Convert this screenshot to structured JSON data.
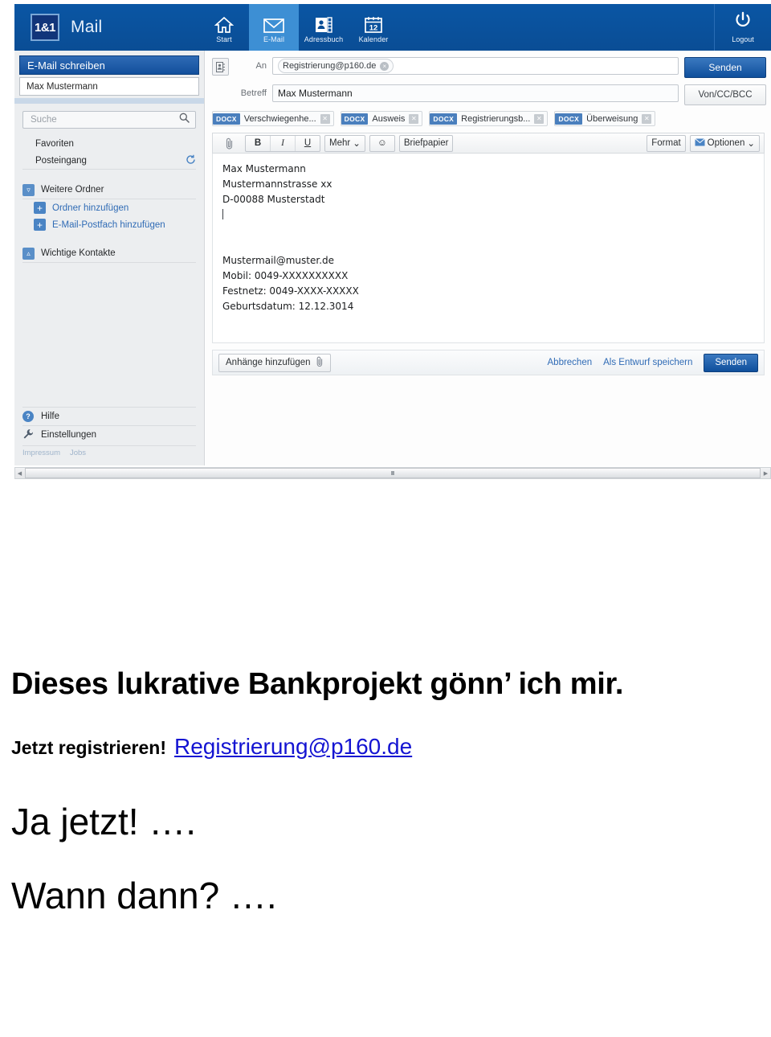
{
  "header": {
    "logo_text": "1&1",
    "brand": "Mail",
    "nav": [
      {
        "label": "Start",
        "icon": "home-icon",
        "active": false
      },
      {
        "label": "E-Mail",
        "icon": "envelope-icon",
        "active": true
      },
      {
        "label": "Adressbuch",
        "icon": "contacts-icon",
        "active": false
      },
      {
        "label": "Kalender",
        "icon": "calendar-icon",
        "active": false
      }
    ],
    "calendar_day": "12",
    "logout": {
      "label": "Logout",
      "icon": "power-icon"
    },
    "accent_blue": "#0a56a4",
    "active_tab_blue": "#3d8fd4"
  },
  "sidebar": {
    "compose_button": "E-Mail schreiben",
    "sender": "Max Mustermann",
    "search": {
      "placeholder": "Suche",
      "value": "",
      "icon": "search-icon"
    },
    "folders": [
      {
        "label": "Favoriten",
        "icon": ""
      },
      {
        "label": "Posteingang",
        "icon": "refresh-icon"
      }
    ],
    "more_folders": {
      "label": "Weitere Ordner",
      "icon": "chevron-double-down-icon"
    },
    "more_items": [
      {
        "label": "Ordner hinzufügen",
        "icon": "plus-icon"
      },
      {
        "label": "E-Mail-Postfach hinzufügen",
        "icon": "plus-icon"
      }
    ],
    "contacts": {
      "label": "Wichtige Kontakte",
      "icon": "chevron-double-up-icon"
    },
    "footer": [
      {
        "label": "Hilfe",
        "icon": "help-icon"
      },
      {
        "label": "Einstellungen",
        "icon": "wrench-icon"
      }
    ],
    "links": [
      "Impressum",
      "Jobs"
    ]
  },
  "compose": {
    "to_label": "An",
    "to_icon": "address-book-icon",
    "recipient": "Registrierung@p160.de",
    "recipient_remove": "×",
    "subject_label": "Betreff",
    "subject": "Max Mustermann",
    "send_button": "Senden",
    "von_cc_bcc_button": "Von/CC/BCC",
    "attachments": [
      {
        "type": "DOCX",
        "name": "Verschwiegenhe..."
      },
      {
        "type": "DOCX",
        "name": "Ausweis"
      },
      {
        "type": "DOCX",
        "name": "Registrierungsb..."
      },
      {
        "type": "DOCX",
        "name": "Überweisung"
      }
    ],
    "toolbar": {
      "attach_icon": "paperclip-icon",
      "bold": "B",
      "italic": "I",
      "underline": "U",
      "more": "Mehr",
      "emoji_icon": "smiley-icon",
      "stationery": "Briefpapier",
      "format": "Format",
      "options": "Optionen",
      "options_icon": "envelope-small-icon"
    },
    "body_lines": [
      "Max Mustermann",
      "Mustermannstrasse xx",
      "D-00088 Musterstadt",
      "",
      "",
      "",
      "Mustermail@muster.de",
      "Mobil: 0049-XXXXXXXXXX",
      "Festnetz: 0049-XXXX-XXXXX",
      "Geburtsdatum: 12.12.3014"
    ],
    "footer": {
      "add_attachments": "Anhänge hinzufügen",
      "add_attachments_icon": "paperclip-icon",
      "cancel": "Abbrechen",
      "save_draft": "Als Entwurf speichern",
      "send": "Senden"
    }
  },
  "caption": {
    "headline": "Dieses lukrative Bankprojekt gönn’ ich mir.",
    "cta_text": "Jetzt registrieren!",
    "cta_link": "Registrierung@p160.de",
    "link_color": "#1414d2",
    "line_yes": "Ja jetzt! ….",
    "line_when": "Wann dann? …."
  }
}
